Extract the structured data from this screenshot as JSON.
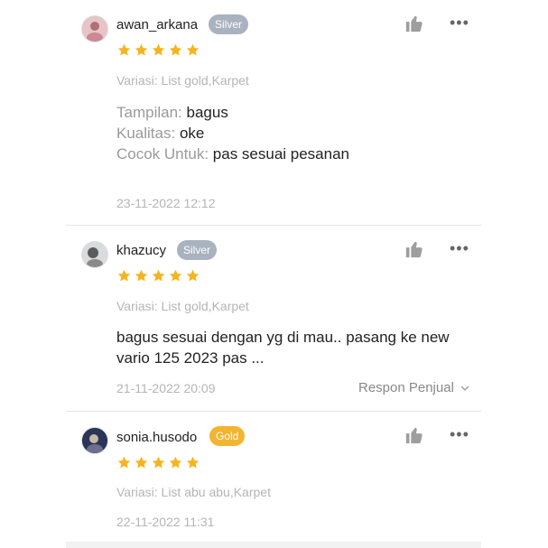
{
  "reviews": [
    {
      "username": "awan_arkana",
      "badge": "Silver",
      "rating": 5,
      "variasi": "Variasi: List gold,Karpet",
      "lines": [
        {
          "label": "Tampilan:",
          "value": "bagus"
        },
        {
          "label": "Kualitas:",
          "value": "oke"
        },
        {
          "label": "Cocok Untuk:",
          "value": "pas sesuai pesanan"
        }
      ],
      "date": "23-11-2022 12:12"
    },
    {
      "username": "khazucy",
      "badge": "Silver",
      "rating": 5,
      "variasi": "Variasi: List gold,Karpet",
      "text": "bagus sesuai dengan yg di mau.. pasang ke new vario 125 2023 pas ...",
      "date": "21-11-2022 20:09",
      "respon": "Respon Penjual"
    },
    {
      "username": "sonia.husodo",
      "badge": "Gold",
      "rating": 5,
      "variasi": "Variasi: List abu abu,Karpet",
      "date": "22-11-2022 11:31"
    }
  ],
  "colors": {
    "star": "#f6b51e",
    "silver": "#a9b2bf",
    "gold": "#f3b431"
  },
  "icons": {
    "like": "thumbs-up-icon",
    "more": "more-dots-icon",
    "respon": "chevron-down-icon"
  }
}
